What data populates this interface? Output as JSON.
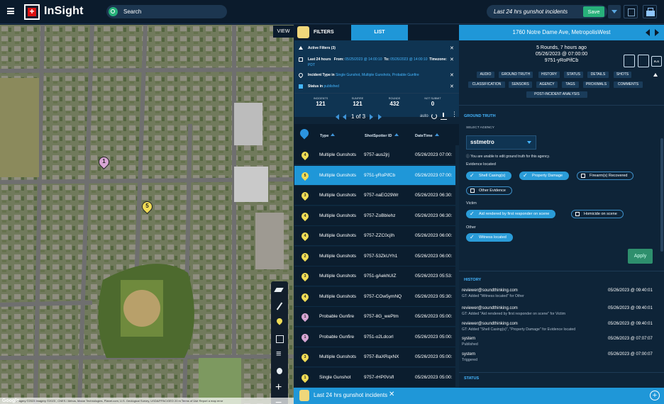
{
  "app": {
    "title": "InSight"
  },
  "search": {
    "placeholder": "Search"
  },
  "saved_search": {
    "label": "Last 24 hrs gunshot incidents",
    "save_label": "Save"
  },
  "map": {
    "view_label": "VIEW",
    "attribution": "Imagery ©2023 Imagery ©2023 , CNES / Airbus, Maxar Technologies, Planet.com, U.S. Geological Survey, USDA/FPAC/GEO   20 m   Terms of Use   Report a map error",
    "google": "Google",
    "markers": [
      {
        "num": "1",
        "color": "#d8a6d4"
      },
      {
        "num": "5",
        "color": "#f0dc55"
      }
    ]
  },
  "list_panel": {
    "tab_filters": "FILTERS",
    "tab_list": "LIST",
    "active_filters": "Active Filters (3)",
    "filters": [
      {
        "label": "Last 24 hours",
        "from_label": "From:",
        "from": "05/25/2023 @ 14:00:10",
        "to_label": "To:",
        "to": "05/26/2023 @ 14:00:10",
        "tz_label": "Timezone:",
        "tz": "PDT"
      },
      {
        "label": "Incident Type in",
        "value": "Single Gunshot, Multiple Gunshots, Probable Gunfire"
      },
      {
        "label": "Status in",
        "value": "published"
      }
    ],
    "stats": [
      {
        "label": "INCIDENTS",
        "value": "121"
      },
      {
        "label": "SUNFIRE",
        "value": "121"
      },
      {
        "label": "ROUNDS",
        "value": "432"
      },
      {
        "label": "NOT SUBMIT",
        "value": "0"
      }
    ],
    "pager": {
      "text": "1 of 3",
      "auto": "auto"
    },
    "columns": {
      "type": "Type",
      "id": "ShotSpotter ID",
      "date": "DateTime"
    },
    "rows": [
      {
        "num": "4",
        "color": "#f0dc55",
        "type": "Multiple Gunshots",
        "id": "9757-aus2jrj",
        "date": "05/26/2023 07:00:"
      },
      {
        "num": "5",
        "color": "#f0dc55",
        "type": "Multiple Gunshots",
        "id": "9751-yRoPifCb",
        "date": "05/26/2023 07:00:"
      },
      {
        "num": "3",
        "color": "#f0dc55",
        "type": "Multiple Gunshots",
        "id": "9757-naEO29Wr",
        "date": "05/26/2023 06:30:"
      },
      {
        "num": "4",
        "color": "#f0dc55",
        "type": "Multiple Gunshots",
        "id": "9757-ZoBbIehz",
        "date": "05/26/2023 06:30:"
      },
      {
        "num": "4",
        "color": "#f0dc55",
        "type": "Multiple Gunshots",
        "id": "9757-ZZC0cjIh",
        "date": "05/26/2023 06:00:"
      },
      {
        "num": "2",
        "color": "#f0dc55",
        "type": "Multiple Gunshots",
        "id": "9757-53ZkUYh1",
        "date": "05/26/2023 06:00:"
      },
      {
        "num": "3",
        "color": "#f0dc55",
        "type": "Multiple Gunshots",
        "id": "9751-gAekhUIZ",
        "date": "05/26/2023 05:53:"
      },
      {
        "num": "4",
        "color": "#f0dc55",
        "type": "Multiple Gunshots",
        "id": "9757-COw5ymNQ",
        "date": "05/26/2023 05:30:"
      },
      {
        "num": "1",
        "color": "#d8a6d4",
        "type": "Probable Gunfire",
        "id": "9757-8G_wePtm",
        "date": "05/26/2023 05:00:"
      },
      {
        "num": "1",
        "color": "#d8a6d4",
        "type": "Probable Gunfire",
        "id": "9751-o2Ldcorl",
        "date": "05/26/2023 05:00:"
      },
      {
        "num": "3",
        "color": "#f0dc55",
        "type": "Multiple Gunshots",
        "id": "9757-BaXRqxNX",
        "date": "05/26/2023 05:00:"
      },
      {
        "num": "1",
        "color": "#f0dc55",
        "type": "Single Gunshot",
        "id": "9757-rHP0Vsfl",
        "date": "05/26/2023 05:00:"
      }
    ]
  },
  "bottom": {
    "tab_label": "Last 24 hrs gunshot incidents"
  },
  "detail": {
    "address": "1760 Notre Dame Ave, MetropolisWest",
    "summary_rounds": "5 Rounds, 7 hours ago",
    "summary_date": "05/26/2023 @ 07:00:00",
    "summary_id": "9751-yRoPifCb",
    "rs_label": "R-S",
    "tabs": [
      "AUDIO",
      "GROUND TRUTH",
      "HISTORY",
      "STATUS",
      "DETAILS",
      "SHOTS",
      "CLASSIFICATION",
      "SENSORS",
      "AGENCY",
      "TAGS",
      "PROXIMALS",
      "COMMENTS",
      "POST-INCIDENT ANALYSIS"
    ],
    "ground_truth": {
      "title": "GROUND TRUTH",
      "agency_label": "SELECT AGENCY",
      "agency_value": "sstmetro",
      "note": "ⓘ You are unable to edit ground truth for this agency.",
      "evidence_label": "Evidence located",
      "evidence": [
        {
          "label": "Shell Casing(s)",
          "on": true
        },
        {
          "label": "Property Damage",
          "on": true
        },
        {
          "label": "Firearm(s) Recovered",
          "on": false
        },
        {
          "label": "Other Evidence",
          "on": false
        }
      ],
      "victim_label": "Victim",
      "victim": [
        {
          "label": "Aid rendered by first responder on scene",
          "on": true
        },
        {
          "label": "Homicide on scene",
          "on": false
        }
      ],
      "other_label": "Other",
      "other": [
        {
          "label": "Witness located",
          "on": true
        }
      ],
      "apply_label": "Apply"
    },
    "history": {
      "title": "HISTORY",
      "items": [
        {
          "user": "reviewer@soundthinking.com",
          "date": "05/26/2023 @ 09:40:01",
          "detail": "GT: Added \"Witness located\" for Other"
        },
        {
          "user": "reviewer@soundthinking.com",
          "date": "05/26/2023 @ 09:40:01",
          "detail": "GT: Added \"Aid rendered by first responder on scene\" for Victim"
        },
        {
          "user": "reviewer@soundthinking.com",
          "date": "05/26/2023 @ 09:40:01",
          "detail": "GT: Added \"Shell Casing(s)\", \"Property Damage\" for Evidence located"
        },
        {
          "user": "system",
          "date": "05/26/2023 @ 07:07:07",
          "detail": "Published"
        },
        {
          "user": "system",
          "date": "05/26/2023 @ 07:00:07",
          "detail": "Triggered"
        }
      ]
    },
    "status_title": "STATUS"
  }
}
